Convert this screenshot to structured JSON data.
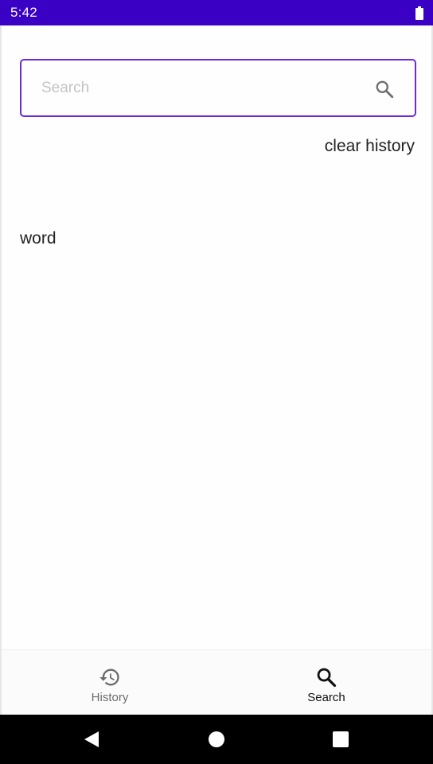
{
  "status_bar": {
    "time": "5:42",
    "icons": [
      "battery-icon"
    ],
    "background_color": "#3a00c4"
  },
  "search": {
    "placeholder": "Search",
    "value": "",
    "button_icon": "search-icon",
    "border_color": "#6a2bd6"
  },
  "history": {
    "clear_label": "clear history",
    "items": [
      {
        "word": "word"
      }
    ]
  },
  "bottom_nav": {
    "items": [
      {
        "label": "History",
        "icon": "history-icon",
        "selected": false
      },
      {
        "label": "Search",
        "icon": "search-icon",
        "selected": true
      }
    ]
  },
  "system_nav": {
    "buttons": [
      "back-icon",
      "home-icon",
      "recents-icon"
    ]
  }
}
